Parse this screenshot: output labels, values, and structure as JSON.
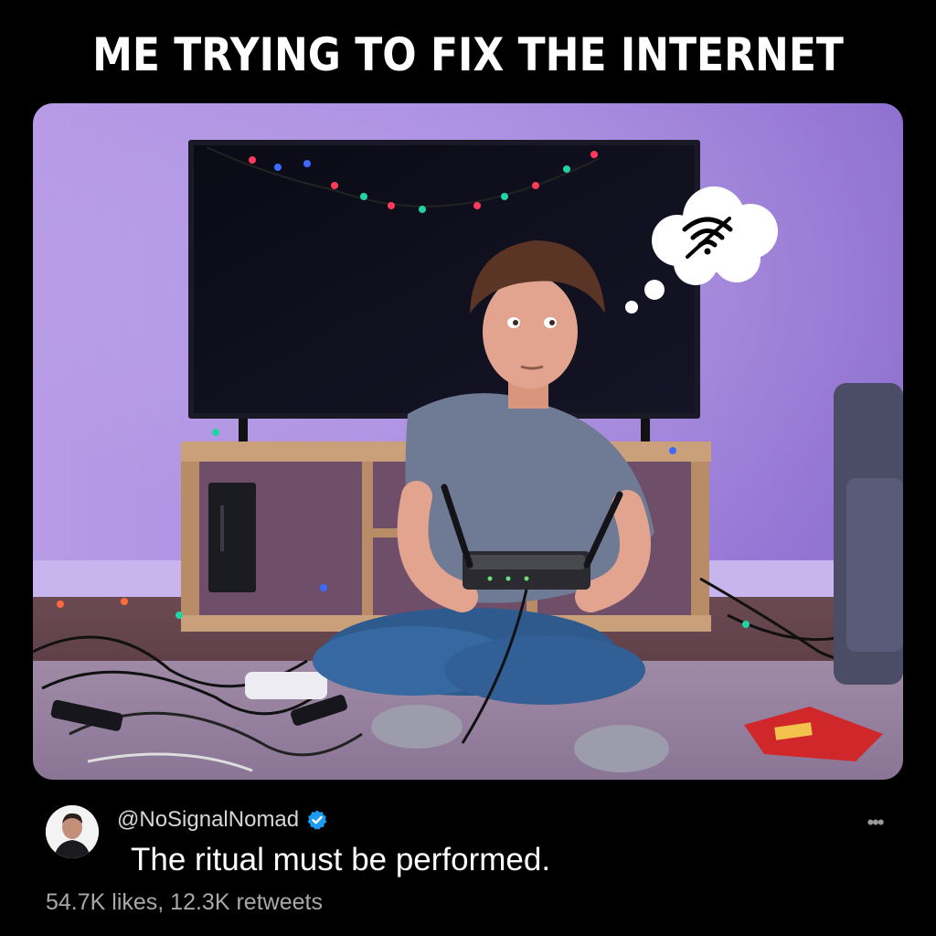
{
  "meme": {
    "title": "ME TRYING TO FIX THE INTERNET"
  },
  "photo": {
    "alt_subject": "wifi-thought-bubble",
    "accent_wall": "#9b7ad6"
  },
  "tweet": {
    "avatar_icon": "user-avatar",
    "handle": "@NoSignalNomad",
    "verified_icon": "verified-badge-icon",
    "verified_color": "#1d9bf0",
    "text": "The ritual must be performed.",
    "engagement": "54.7K likes, 12.3K retweets",
    "more_icon": "more-options-icon",
    "more_glyph": "•••"
  }
}
